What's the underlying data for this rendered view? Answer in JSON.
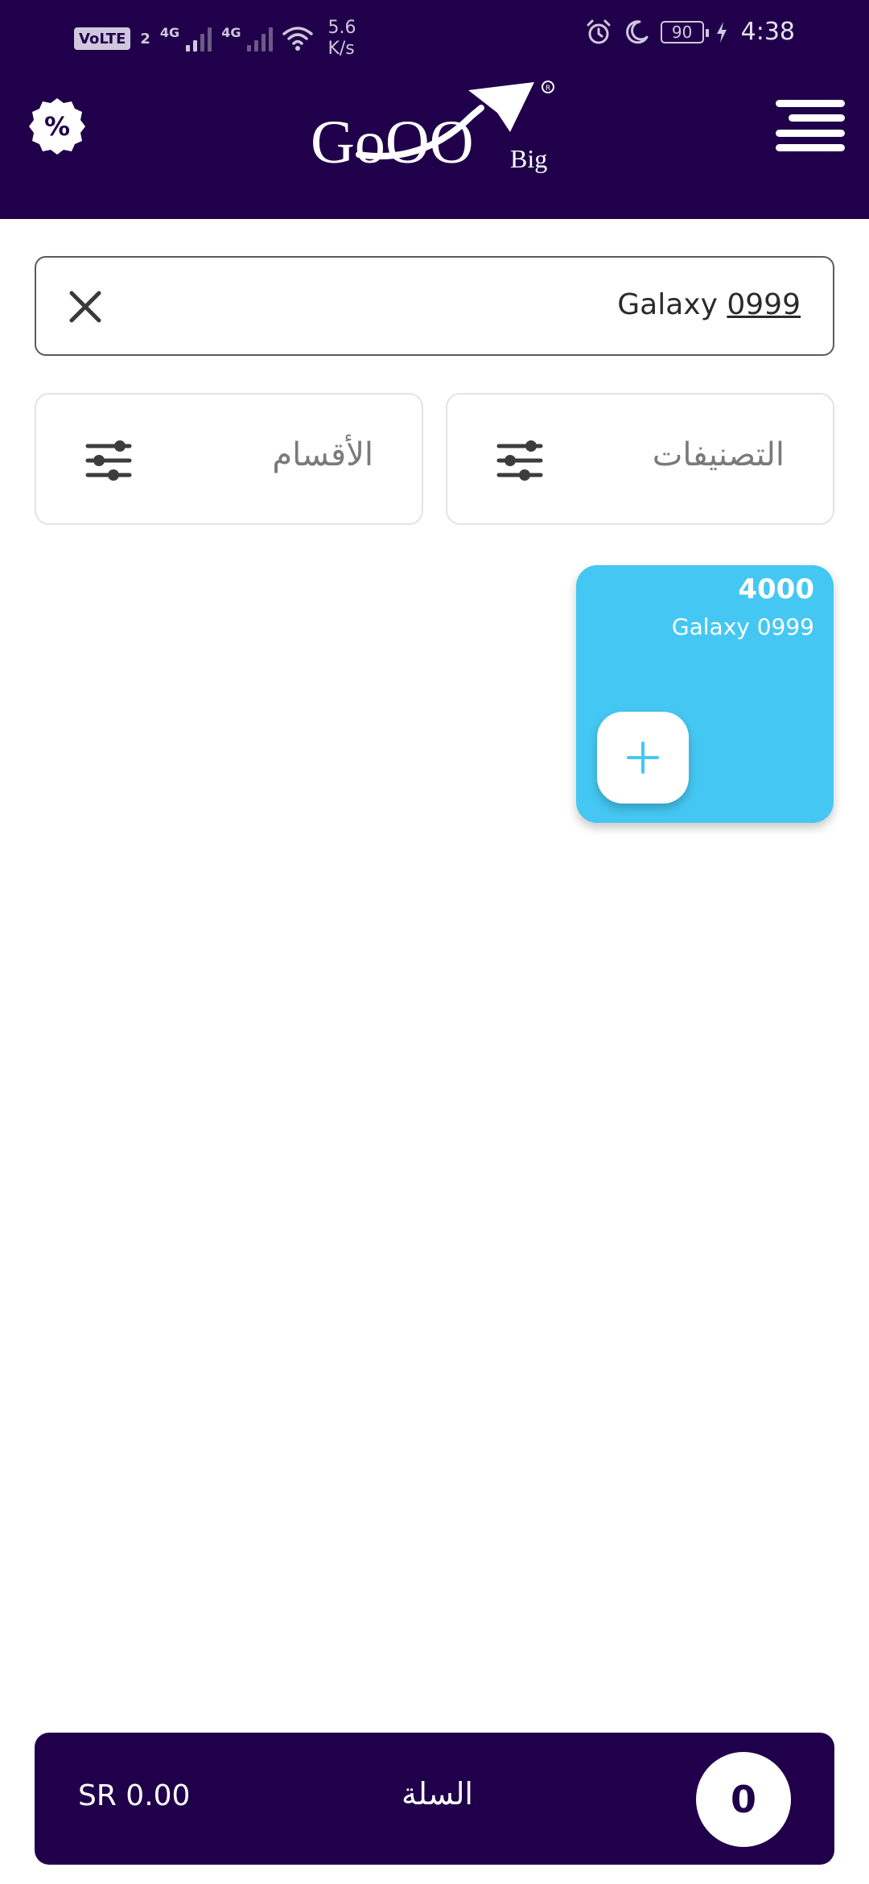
{
  "status_bar": {
    "volte_label": "VoLTE",
    "sim_number": "2",
    "network_1": "4G",
    "network_2": "4G",
    "speed_value": "5.6",
    "speed_unit": "K/s",
    "battery_level": "90",
    "time": "4:38"
  },
  "header": {
    "logo_text": "GoOO",
    "logo_sub": "Big",
    "discount_icon": "percent-badge-icon",
    "menu_icon": "hamburger-menu-icon",
    "background_color": "#20004a"
  },
  "search": {
    "value_word": "Galaxy",
    "value_number": "0999",
    "clear_icon": "close-icon"
  },
  "filters": {
    "categories_label": "التصنيفات",
    "sections_label": "الأقسام",
    "icon": "sliders-icon"
  },
  "products": [
    {
      "price": "4000",
      "name": "Galaxy 0999",
      "add_icon": "plus-icon",
      "card_color": "#44c8f3"
    }
  ],
  "cart": {
    "total": "SR 0.00",
    "label": "السلة",
    "count": "0"
  }
}
